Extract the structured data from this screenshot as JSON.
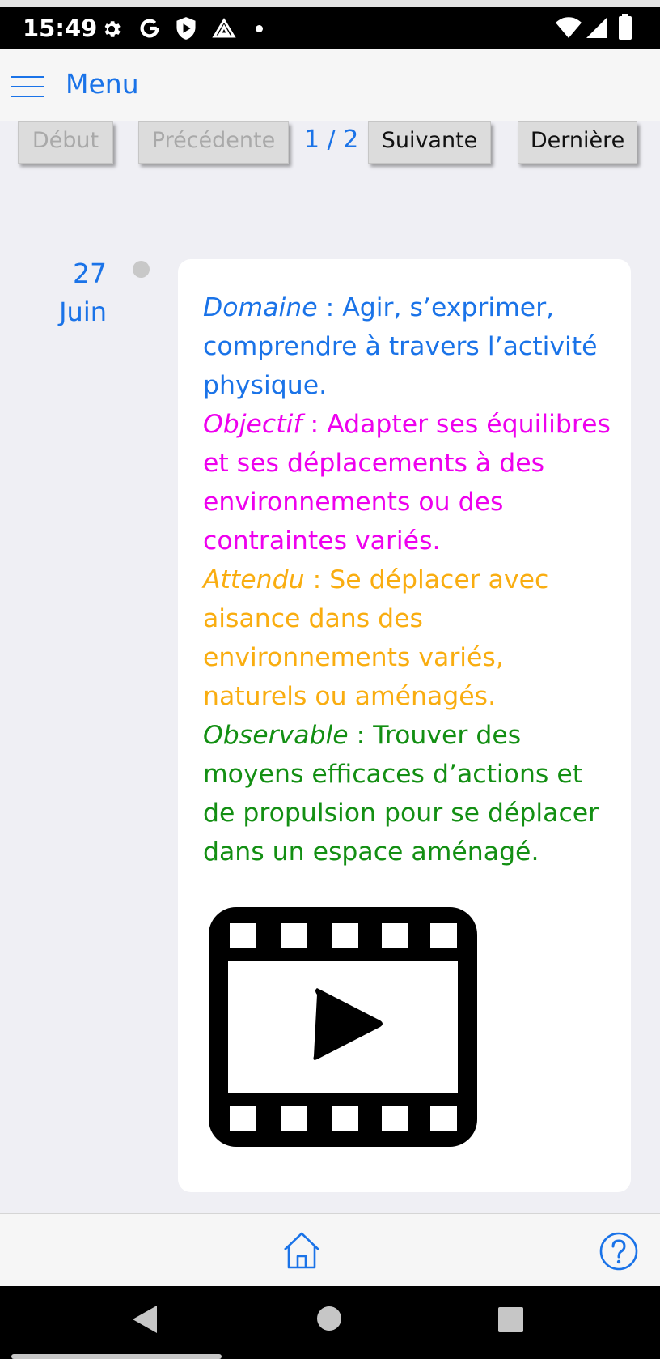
{
  "status_bar": {
    "time": "15:49",
    "left_icons": [
      "gear-icon",
      "google-icon",
      "shield-play-icon",
      "drive-icon",
      "notification-dot-icon"
    ],
    "right_icons": [
      "wifi-icon",
      "cell-signal-icon",
      "battery-icon"
    ]
  },
  "header": {
    "menu_label": "Menu",
    "menu_icon": "hamburger-icon"
  },
  "pager": {
    "first_label": "Début",
    "prev_label": "Précédente",
    "page_indicator": "1 / 2",
    "next_label": "Suivante",
    "last_label": "Dernière"
  },
  "entry": {
    "day": "27",
    "month": "Juin",
    "domaine_label": "Domaine",
    "domaine_text": " : Agir, s’exprimer, comprendre à travers l’activité physique.",
    "objectif_label": "Objectif",
    "objectif_text": " : Adapter ses équilibres et ses déplacements à des environnements ou des contraintes variés.",
    "attendu_label": "Attendu",
    "attendu_text": " : Se déplacer avec aisance dans des environnements variés, naturels ou aménagés.",
    "observable_label": "Observable",
    "observable_text": " : Trouver des moyens efficaces d’actions et de propulsion pour se déplacer dans un espace aménagé.",
    "media_icon": "video-film-play-icon"
  },
  "bottom_bar": {
    "home_icon": "home-icon",
    "help_icon": "help-circle-icon"
  },
  "nav_bar": {
    "icons": [
      "back-icon",
      "home-circle-icon",
      "recents-icon"
    ]
  },
  "colors": {
    "accent": "#1a73e8",
    "objectif": "#ee00ee",
    "attendu": "#f9ad10",
    "observable": "#138f13"
  }
}
